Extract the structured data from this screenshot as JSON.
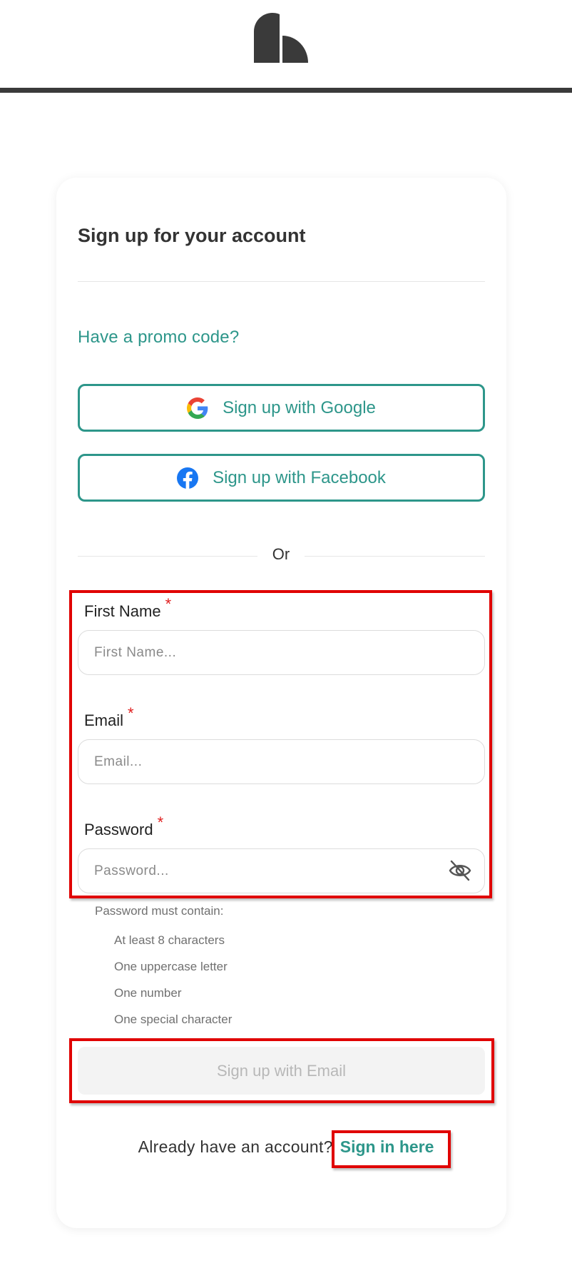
{
  "header": {
    "logo_icon": "brand-logo-icon"
  },
  "form": {
    "title": "Sign up for your account",
    "promo_link": "Have a promo code?",
    "google_button": {
      "label": "Sign up with Google",
      "icon": "google-icon"
    },
    "facebook_button": {
      "label": "Sign up with Facebook",
      "icon": "facebook-icon"
    },
    "divider_text": "Or",
    "required_marker": "*",
    "fields": {
      "first_name": {
        "label": "First Name",
        "placeholder": "First Name...",
        "value": ""
      },
      "email": {
        "label": "Email",
        "placeholder": "Email...",
        "value": ""
      },
      "password": {
        "label": "Password",
        "placeholder": "Password...",
        "value": "",
        "toggle_icon": "eye-slash-icon"
      }
    },
    "password_rules": {
      "title": "Password must contain:",
      "items": [
        "At least 8 characters",
        "One uppercase letter",
        "One number",
        "One special character"
      ]
    },
    "submit_label": "Sign up with Email",
    "signin_prompt": "Already have an account?",
    "signin_link": "Sign in here"
  },
  "colors": {
    "accent": "#2d968a",
    "required": "#e02020",
    "highlight": "#e00000",
    "header_rule": "#3a3a3a",
    "disabled_bg": "#f3f3f3",
    "disabled_text": "#b8b8b8"
  }
}
